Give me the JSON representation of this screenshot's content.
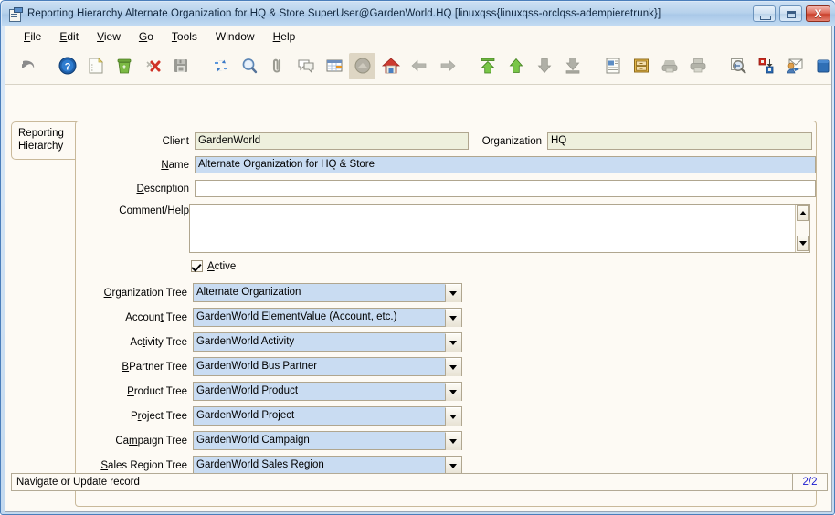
{
  "window": {
    "title": "Reporting Hierarchy  Alternate Organization for HQ & Store  SuperUser@GardenWorld.HQ [linuxqss{linuxqss-orclqss-adempieretrunk}]",
    "app_icon": "window-document-icon",
    "controls": {
      "minimize": "minimize-icon",
      "maximize": "maximize-icon",
      "close": "X"
    }
  },
  "menubar": [
    {
      "label": "File",
      "mnemonic": "F"
    },
    {
      "label": "Edit",
      "mnemonic": "E"
    },
    {
      "label": "View",
      "mnemonic": "V"
    },
    {
      "label": "Go",
      "mnemonic": "G"
    },
    {
      "label": "Tools",
      "mnemonic": "T"
    },
    {
      "label": "Window",
      "mnemonic": ""
    },
    {
      "label": "Help",
      "mnemonic": "H"
    }
  ],
  "toolbar": [
    {
      "name": "undo-icon",
      "tooltip": "Undo",
      "enabled": false
    },
    {
      "name": "separator",
      "tooltip": "",
      "enabled": false
    },
    {
      "name": "help-icon",
      "tooltip": "Help",
      "enabled": true
    },
    {
      "name": "new-record-icon",
      "tooltip": "New Record",
      "enabled": true
    },
    {
      "name": "delete-record-icon",
      "tooltip": "Delete Record",
      "enabled": true
    },
    {
      "name": "delete-selection-icon",
      "tooltip": "Delete Selection",
      "enabled": true
    },
    {
      "name": "save-icon",
      "tooltip": "Save Changes",
      "enabled": false
    },
    {
      "name": "separator",
      "tooltip": "",
      "enabled": false
    },
    {
      "name": "refresh-icon",
      "tooltip": "Refresh",
      "enabled": true
    },
    {
      "name": "find-icon",
      "tooltip": "Find Records",
      "enabled": true
    },
    {
      "name": "attachment-icon",
      "tooltip": "Attachment",
      "enabled": true
    },
    {
      "name": "chat-icon",
      "tooltip": "Chat",
      "enabled": true
    },
    {
      "name": "grid-toggle-icon",
      "tooltip": "Grid Toggle",
      "enabled": true
    },
    {
      "name": "history-icon",
      "tooltip": "History Records",
      "enabled": false
    },
    {
      "name": "home-icon",
      "tooltip": "Home",
      "enabled": true
    },
    {
      "name": "back-icon",
      "tooltip": "Parent Record",
      "enabled": false
    },
    {
      "name": "forward-icon",
      "tooltip": "Detail Record",
      "enabled": false
    },
    {
      "name": "first-record-icon",
      "tooltip": "First Record",
      "enabled": true
    },
    {
      "name": "previous-record-icon",
      "tooltip": "Previous Record",
      "enabled": true
    },
    {
      "name": "next-record-icon",
      "tooltip": "Next Record",
      "enabled": false
    },
    {
      "name": "last-record-icon",
      "tooltip": "Last Record",
      "enabled": false
    },
    {
      "name": "separator",
      "tooltip": "",
      "enabled": false
    },
    {
      "name": "report-icon",
      "tooltip": "Report",
      "enabled": true
    },
    {
      "name": "archive-icon",
      "tooltip": "Archived Documents",
      "enabled": true
    },
    {
      "name": "print-preview-icon",
      "tooltip": "Print Preview",
      "enabled": false
    },
    {
      "name": "print-icon",
      "tooltip": "Print",
      "enabled": false
    },
    {
      "name": "zoom-across-icon",
      "tooltip": "Zoom Across",
      "enabled": false
    },
    {
      "name": "active-workflow-icon",
      "tooltip": "Active Workflow",
      "enabled": true
    },
    {
      "name": "request-icon",
      "tooltip": "Requests",
      "enabled": true
    },
    {
      "name": "product-info-icon",
      "tooltip": "Product Info",
      "enabled": true
    },
    {
      "name": "exit-icon",
      "tooltip": "Exit",
      "enabled": true
    }
  ],
  "tab": {
    "line1": "Reporting",
    "line2": "Hierarchy"
  },
  "form": {
    "client": {
      "label": "Client",
      "mnemonic": "",
      "value": "GardenWorld",
      "readonly": true
    },
    "organization": {
      "label": "Organization",
      "mnemonic": "",
      "value": "HQ",
      "readonly": true
    },
    "name": {
      "label": "Name",
      "mnemonic": "N",
      "value": "Alternate Organization for HQ & Store",
      "readonly": false
    },
    "description": {
      "label": "Description",
      "mnemonic": "D",
      "value": "",
      "readonly": false
    },
    "comment_help": {
      "label": "Comment/Help",
      "mnemonic": "C",
      "value": ""
    },
    "active": {
      "label": "Active",
      "mnemonic": "A",
      "checked": true
    },
    "trees": [
      {
        "label_pre": "",
        "mnemonic": "O",
        "label_post": "rganization Tree",
        "value": "Alternate Organization"
      },
      {
        "label_pre": "Accoun",
        "mnemonic": "t",
        "label_post": " Tree",
        "value": "GardenWorld ElementValue (Account, etc.)"
      },
      {
        "label_pre": "Ac",
        "mnemonic": "t",
        "label_post": "ivity Tree",
        "value": "GardenWorld Activity"
      },
      {
        "label_pre": "",
        "mnemonic": "B",
        "label_post": "Partner Tree",
        "value": "GardenWorld Bus Partner"
      },
      {
        "label_pre": "",
        "mnemonic": "P",
        "label_post": "roduct Tree",
        "value": "GardenWorld Product"
      },
      {
        "label_pre": "P",
        "mnemonic": "r",
        "label_post": "oject Tree",
        "value": "GardenWorld Project"
      },
      {
        "label_pre": "Ca",
        "mnemonic": "m",
        "label_post": "paign Tree",
        "value": "GardenWorld Campaign"
      },
      {
        "label_pre": "",
        "mnemonic": "S",
        "label_post": "ales Region Tree",
        "value": "GardenWorld Sales Region"
      }
    ]
  },
  "statusbar": {
    "message": "Navigate or Update record",
    "record_count": "2/2"
  },
  "colors": {
    "readonly_field": "#eef0dd",
    "editable_field": "#c9dcf2",
    "panel_bg": "#fdfaf4",
    "panel_border": "#c9b99a",
    "titlebar": "#b7d2ec",
    "count_text": "#1a1ad0"
  }
}
